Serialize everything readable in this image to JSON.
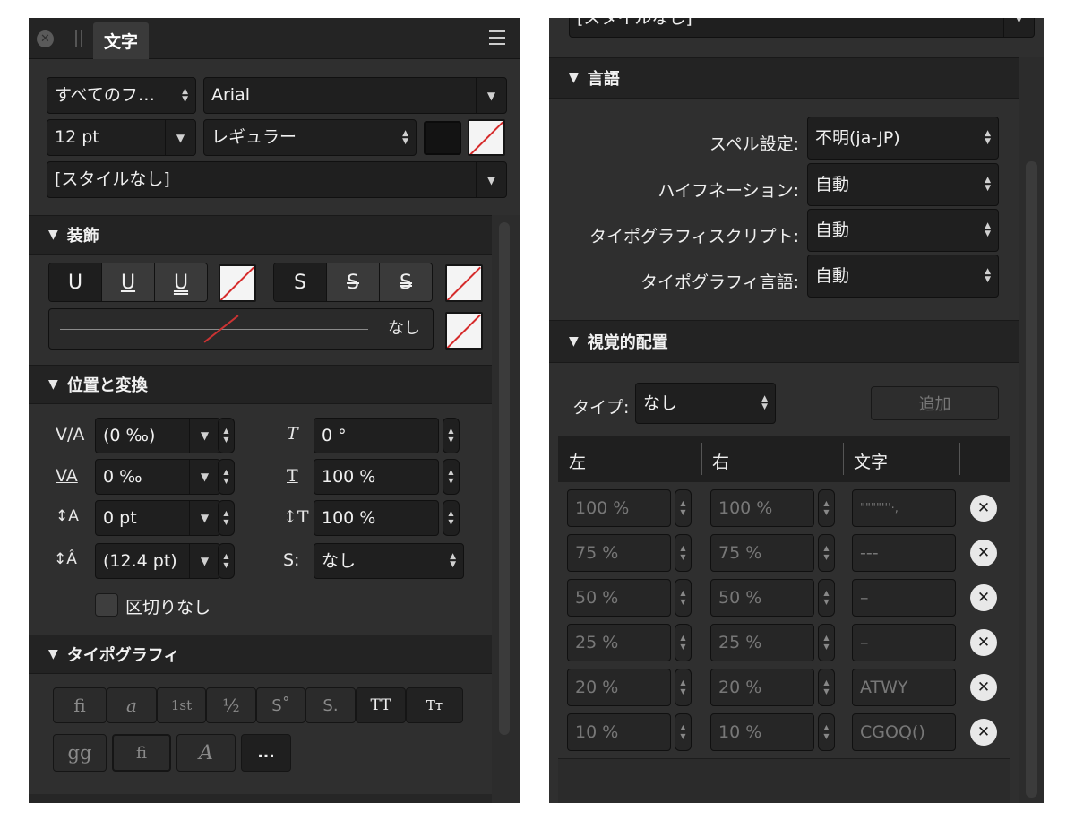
{
  "left_panel": {
    "tab_title": "文字",
    "font_collection": "すべてのフ…",
    "font_family": "Arial",
    "font_size": "12 pt",
    "font_style": "レギュラー",
    "style": "[スタイルなし]",
    "decoration": {
      "header": "装飾",
      "underline_buttons": [
        "U",
        "U",
        "U"
      ],
      "strike_buttons": [
        "S",
        "S",
        "S"
      ],
      "line_value": "なし"
    },
    "position": {
      "header": "位置と変換",
      "tracking": "(0 ‰)",
      "kerning": "0 ‰",
      "baseline": "0 pt",
      "leading": "(12.4 pt)",
      "skew": "0 °",
      "horizontal_scale": "100 %",
      "vertical_scale": "100 %",
      "script_label": "S:",
      "script": "なし",
      "no_break_label": "区切りなし"
    },
    "typography": {
      "header": "タイポグラフィ",
      "row1": [
        "fi",
        "a",
        "1st",
        "½",
        "S˚",
        "S.",
        "TT",
        "Tт"
      ],
      "row2": [
        "gg",
        "fi",
        "A",
        "..."
      ]
    }
  },
  "right_panel": {
    "style_top": "[スタイルなし]",
    "language": {
      "header": "言語",
      "spelling_label": "スペル設定:",
      "spelling_value": "不明(ja-JP)",
      "hyphenation_label": "ハイフネーション:",
      "hyphenation_value": "自動",
      "script_label": "タイポグラフィスクリプト:",
      "script_value": "自動",
      "lang_label": "タイポグラフィ言語:",
      "lang_value": "自動"
    },
    "visual_alignment": {
      "header": "視覚的配置",
      "type_label": "タイプ:",
      "type_value": "なし",
      "add_button": "追加",
      "columns": [
        "左",
        "右",
        "文字"
      ],
      "rows": [
        {
          "left": "100 %",
          "right": "100 %",
          "chars": "\"\"\"\"'''·,"
        },
        {
          "left": "75 %",
          "right": "75 %",
          "chars": "---"
        },
        {
          "left": "50 %",
          "right": "50 %",
          "chars": "–"
        },
        {
          "left": "25 %",
          "right": "25 %",
          "chars": "–"
        },
        {
          "left": "20 %",
          "right": "20 %",
          "chars": "ATWY"
        },
        {
          "left": "10 %",
          "right": "10 %",
          "chars": "CGOQ()"
        }
      ]
    }
  }
}
